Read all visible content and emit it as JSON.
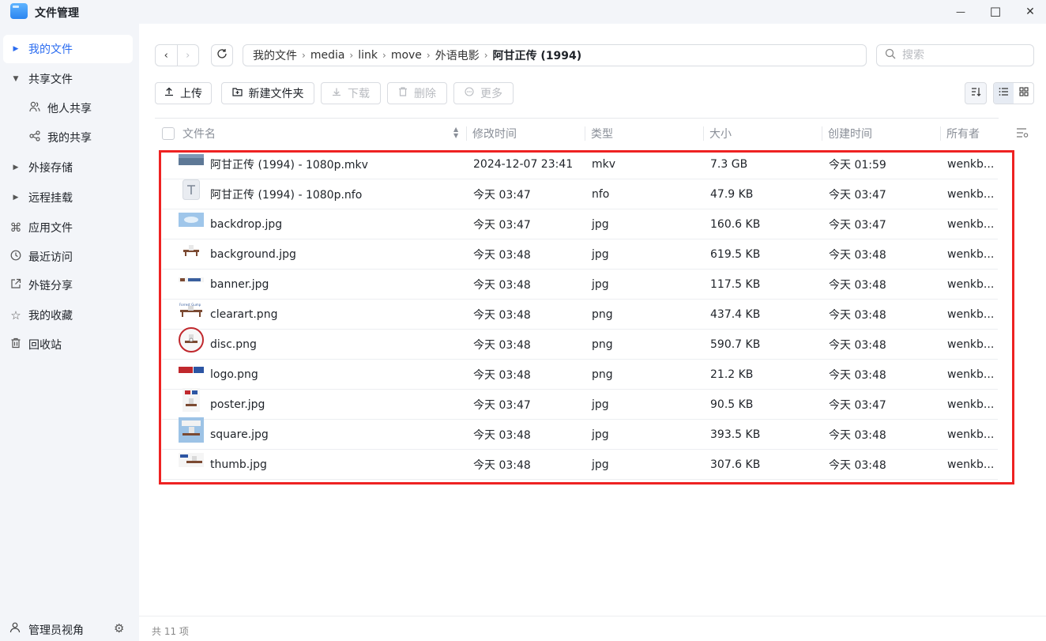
{
  "app": {
    "title": "文件管理"
  },
  "window_controls": {
    "minimize": "—",
    "maximize": "☐",
    "close": "✕"
  },
  "sidebar": {
    "items": [
      {
        "label": "我的文件"
      },
      {
        "label": "共享文件"
      },
      {
        "label": "他人共享"
      },
      {
        "label": "我的共享"
      },
      {
        "label": "外接存储"
      },
      {
        "label": "远程挂载"
      },
      {
        "label": "应用文件"
      },
      {
        "label": "最近访问"
      },
      {
        "label": "外链分享"
      },
      {
        "label": "我的收藏"
      },
      {
        "label": "回收站"
      }
    ],
    "footer": {
      "label": "管理员视角"
    }
  },
  "breadcrumb": [
    "我的文件",
    "media",
    "link",
    "move",
    "外语电影",
    "阿甘正传 (1994)"
  ],
  "search": {
    "placeholder": "搜索"
  },
  "toolbar": {
    "upload": "上传",
    "new_folder": "新建文件夹",
    "download": "下载",
    "delete": "删除",
    "more": "更多"
  },
  "columns": {
    "name": "文件名",
    "modified": "修改时间",
    "type": "类型",
    "size": "大小",
    "created": "创建时间",
    "owner": "所有者"
  },
  "files": [
    {
      "name": "阿甘正传 (1994) - 1080p.mkv",
      "modified": "2024-12-07 23:41",
      "type": "mkv",
      "size": "7.3 GB",
      "created": "今天 01:59",
      "owner": "wenkb...",
      "thumb": "video"
    },
    {
      "name": "阿甘正传 (1994) - 1080p.nfo",
      "modified": "今天 03:47",
      "type": "nfo",
      "size": "47.9 KB",
      "created": "今天 03:47",
      "owner": "wenkb...",
      "thumb": "text"
    },
    {
      "name": "backdrop.jpg",
      "modified": "今天 03:47",
      "type": "jpg",
      "size": "160.6 KB",
      "created": "今天 03:47",
      "owner": "wenkb...",
      "thumb": "sky"
    },
    {
      "name": "background.jpg",
      "modified": "今天 03:48",
      "type": "jpg",
      "size": "619.5 KB",
      "created": "今天 03:48",
      "owner": "wenkb...",
      "thumb": "bench"
    },
    {
      "name": "banner.jpg",
      "modified": "今天 03:48",
      "type": "jpg",
      "size": "117.5 KB",
      "created": "今天 03:48",
      "owner": "wenkb...",
      "thumb": "banner"
    },
    {
      "name": "clearart.png",
      "modified": "今天 03:48",
      "type": "png",
      "size": "437.4 KB",
      "created": "今天 03:48",
      "owner": "wenkb...",
      "thumb": "clearart"
    },
    {
      "name": "disc.png",
      "modified": "今天 03:48",
      "type": "png",
      "size": "590.7 KB",
      "created": "今天 03:48",
      "owner": "wenkb...",
      "thumb": "disc"
    },
    {
      "name": "logo.png",
      "modified": "今天 03:48",
      "type": "png",
      "size": "21.2 KB",
      "created": "今天 03:48",
      "owner": "wenkb...",
      "thumb": "logo"
    },
    {
      "name": "poster.jpg",
      "modified": "今天 03:47",
      "type": "jpg",
      "size": "90.5 KB",
      "created": "今天 03:47",
      "owner": "wenkb...",
      "thumb": "poster"
    },
    {
      "name": "square.jpg",
      "modified": "今天 03:48",
      "type": "jpg",
      "size": "393.5 KB",
      "created": "今天 03:48",
      "owner": "wenkb...",
      "thumb": "square"
    },
    {
      "name": "thumb.jpg",
      "modified": "今天 03:48",
      "type": "jpg",
      "size": "307.6 KB",
      "created": "今天 03:48",
      "owner": "wenkb...",
      "thumb": "thumb"
    }
  ],
  "status": {
    "count": "共 11 项"
  },
  "colors": {
    "accent": "#2b6cf0",
    "highlight_border": "#ee2222",
    "sidebar_bg": "#f3f5f9"
  }
}
